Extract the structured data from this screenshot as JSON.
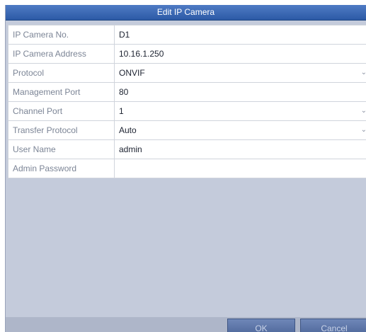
{
  "dialog": {
    "title": "Edit IP Camera"
  },
  "fields": [
    {
      "label": "IP Camera No.",
      "value": "D1",
      "type": "text"
    },
    {
      "label": "IP Camera Address",
      "value": "10.16.1.250",
      "type": "text"
    },
    {
      "label": "Protocol",
      "value": "ONVIF",
      "type": "select"
    },
    {
      "label": "Management Port",
      "value": "80",
      "type": "text"
    },
    {
      "label": "Channel Port",
      "value": "1",
      "type": "select"
    },
    {
      "label": "Transfer Protocol",
      "value": "Auto",
      "type": "select"
    },
    {
      "label": "User Name",
      "value": "admin",
      "type": "text"
    },
    {
      "label": "Admin Password",
      "value": "",
      "type": "password"
    }
  ],
  "buttons": {
    "ok_label": "OK",
    "cancel_label": "Cancel"
  },
  "icons": {
    "dropdown": "chevron-down-icon"
  },
  "colors": {
    "title_bar": "#3a67b3",
    "panel_background": "#c4cbdb",
    "button": "#5a73a8"
  }
}
